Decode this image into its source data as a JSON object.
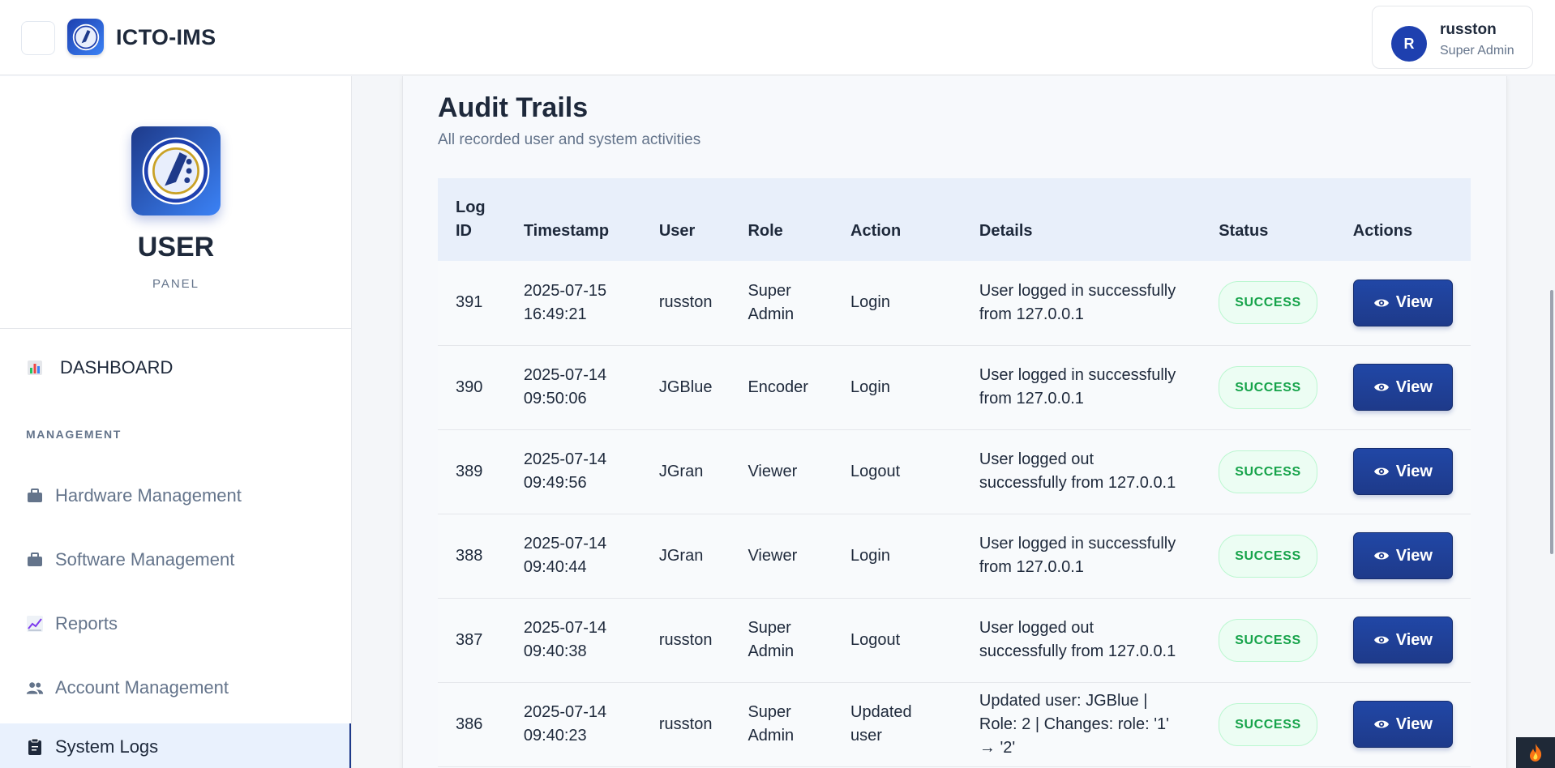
{
  "app": {
    "title": "ICTO-IMS"
  },
  "user": {
    "initial": "R",
    "name": "russton",
    "role": "Super Admin"
  },
  "sidebar": {
    "panel_title": "USER",
    "panel_subtitle": "PANEL",
    "dashboard_label": "DASHBOARD",
    "section_label": "MANAGEMENT",
    "items": [
      {
        "label": "Hardware Management",
        "icon": "briefcase-icon"
      },
      {
        "label": "Software Management",
        "icon": "briefcase-icon"
      },
      {
        "label": "Reports",
        "icon": "chart-line-icon"
      },
      {
        "label": "Account Management",
        "icon": "users-icon"
      },
      {
        "label": "System Logs",
        "icon": "clipboard-icon",
        "active": true
      }
    ]
  },
  "page": {
    "title": "Audit Trails",
    "subtitle": "All recorded user and system activities"
  },
  "table": {
    "headers": [
      "Log ID",
      "Timestamp",
      "User",
      "Role",
      "Action",
      "Details",
      "Status",
      "Actions"
    ],
    "view_label": "View",
    "rows": [
      {
        "id": "391",
        "timestamp": "2025-07-15 16:49:21",
        "user": "russton",
        "role": "Super Admin",
        "action": "Login",
        "details": "User logged in successfully from 127.0.0.1",
        "status": "SUCCESS"
      },
      {
        "id": "390",
        "timestamp": "2025-07-14 09:50:06",
        "user": "JGBlue",
        "role": "Encoder",
        "action": "Login",
        "details": "User logged in successfully from 127.0.0.1",
        "status": "SUCCESS"
      },
      {
        "id": "389",
        "timestamp": "2025-07-14 09:49:56",
        "user": "JGran",
        "role": "Viewer",
        "action": "Logout",
        "details": "User logged out successfully from 127.0.0.1",
        "status": "SUCCESS"
      },
      {
        "id": "388",
        "timestamp": "2025-07-14 09:40:44",
        "user": "JGran",
        "role": "Viewer",
        "action": "Login",
        "details": "User logged in successfully from 127.0.0.1",
        "status": "SUCCESS"
      },
      {
        "id": "387",
        "timestamp": "2025-07-14 09:40:38",
        "user": "russton",
        "role": "Super Admin",
        "action": "Logout",
        "details": "User logged out successfully from 127.0.0.1",
        "status": "SUCCESS"
      },
      {
        "id": "386",
        "timestamp": "2025-07-14 09:40:23",
        "user": "russton",
        "role": "Super Admin",
        "action": "Updated user",
        "details": "Updated user: JGBlue | Role: 2 | Changes: role: '1' → '2'",
        "status": "SUCCESS"
      }
    ]
  },
  "colors": {
    "primary": "#1e3a8a",
    "success": "#16a34a",
    "active_bg": "#e9f1fd"
  }
}
